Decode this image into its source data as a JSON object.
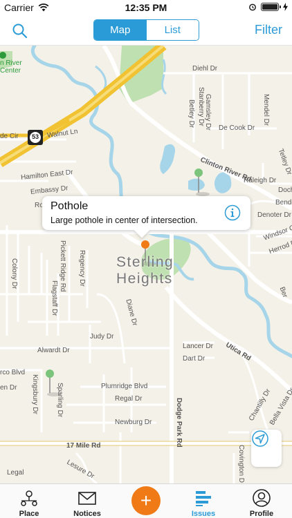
{
  "status": {
    "carrier": "Carrier",
    "time": "12:35 PM"
  },
  "nav": {
    "tabs": [
      "Map",
      "List"
    ],
    "active_tab": "Map",
    "filter_label": "Filter"
  },
  "map": {
    "city_line1": "Sterling",
    "city_line2": "Heights",
    "poi": {
      "line1": "n River",
      "line2": "Center"
    },
    "shield": "53",
    "streets": {
      "diehl": "Diehl Dr",
      "gamsley": "Gamsley Dr",
      "stanberry": "Stanberry Dr",
      "betley": "Betley Dr",
      "mendel": "Mendel Dr",
      "decook": "De Cook Dr",
      "tetley": "Tetley Dr",
      "walnut": "Walnut Ln",
      "de_cir": "de Cir",
      "hamilton": "Hamilton East Dr",
      "embassy": "Embassy Dr",
      "ro": "Ro",
      "clinton": "Clinton River Rd",
      "raleigh": "Raleigh Dr",
      "doch": "Doch",
      "bende": "Bende",
      "denoter": "Denoter Dr",
      "windsor": "Windsor C",
      "herrod": "Herrod Dr",
      "ber": "Ber",
      "colony": "Colony Dr",
      "pickett": "Pickett Ridge Rd",
      "regency": "Regency Dr",
      "flagstaff": "Flagstaff Dr",
      "diane": "Diane Dr",
      "judy": "Judy Dr",
      "alwardt": "Alwardt Dr",
      "lancer": "Lancer Dr",
      "dart": "Dart Dr",
      "utica": "Utica Rd",
      "rco": "rco Blvd",
      "en": "en Dr",
      "kingsbury": "Kingsbury Dr",
      "sparling": "Sparling Dr",
      "plumridge": "Plumridge Blvd",
      "regal": "Regal Dr",
      "newburg": "Newburg Dr",
      "dodge": "Dodge Park Rd",
      "chantilly": "Chantilly Dr",
      "bella": "Bella Vista Dr",
      "mile17": "17 Mile Rd",
      "lesure": "Lesure Dr",
      "covington": "Covington D"
    },
    "legal": "Legal"
  },
  "callout": {
    "title": "Pothole",
    "description": "Large pothole in center of intersection."
  },
  "tabbar": {
    "items": [
      {
        "label": "Place",
        "icon": "place-icon"
      },
      {
        "label": "Notices",
        "icon": "envelope-icon"
      },
      {
        "label": "",
        "icon": "plus-icon"
      },
      {
        "label": "Issues",
        "icon": "issues-icon"
      },
      {
        "label": "Profile",
        "icon": "profile-icon"
      }
    ],
    "active": "Issues",
    "add_symbol": "+"
  },
  "colors": {
    "accent": "#2a9bd6",
    "add_button": "#f07b16",
    "map_bg": "#f4f1e8",
    "water": "#a6d5ea",
    "park": "#bfe0b0",
    "highway": "#f1c232",
    "pin_green": "#7cc47c",
    "pin_orange": "#f07b16"
  }
}
